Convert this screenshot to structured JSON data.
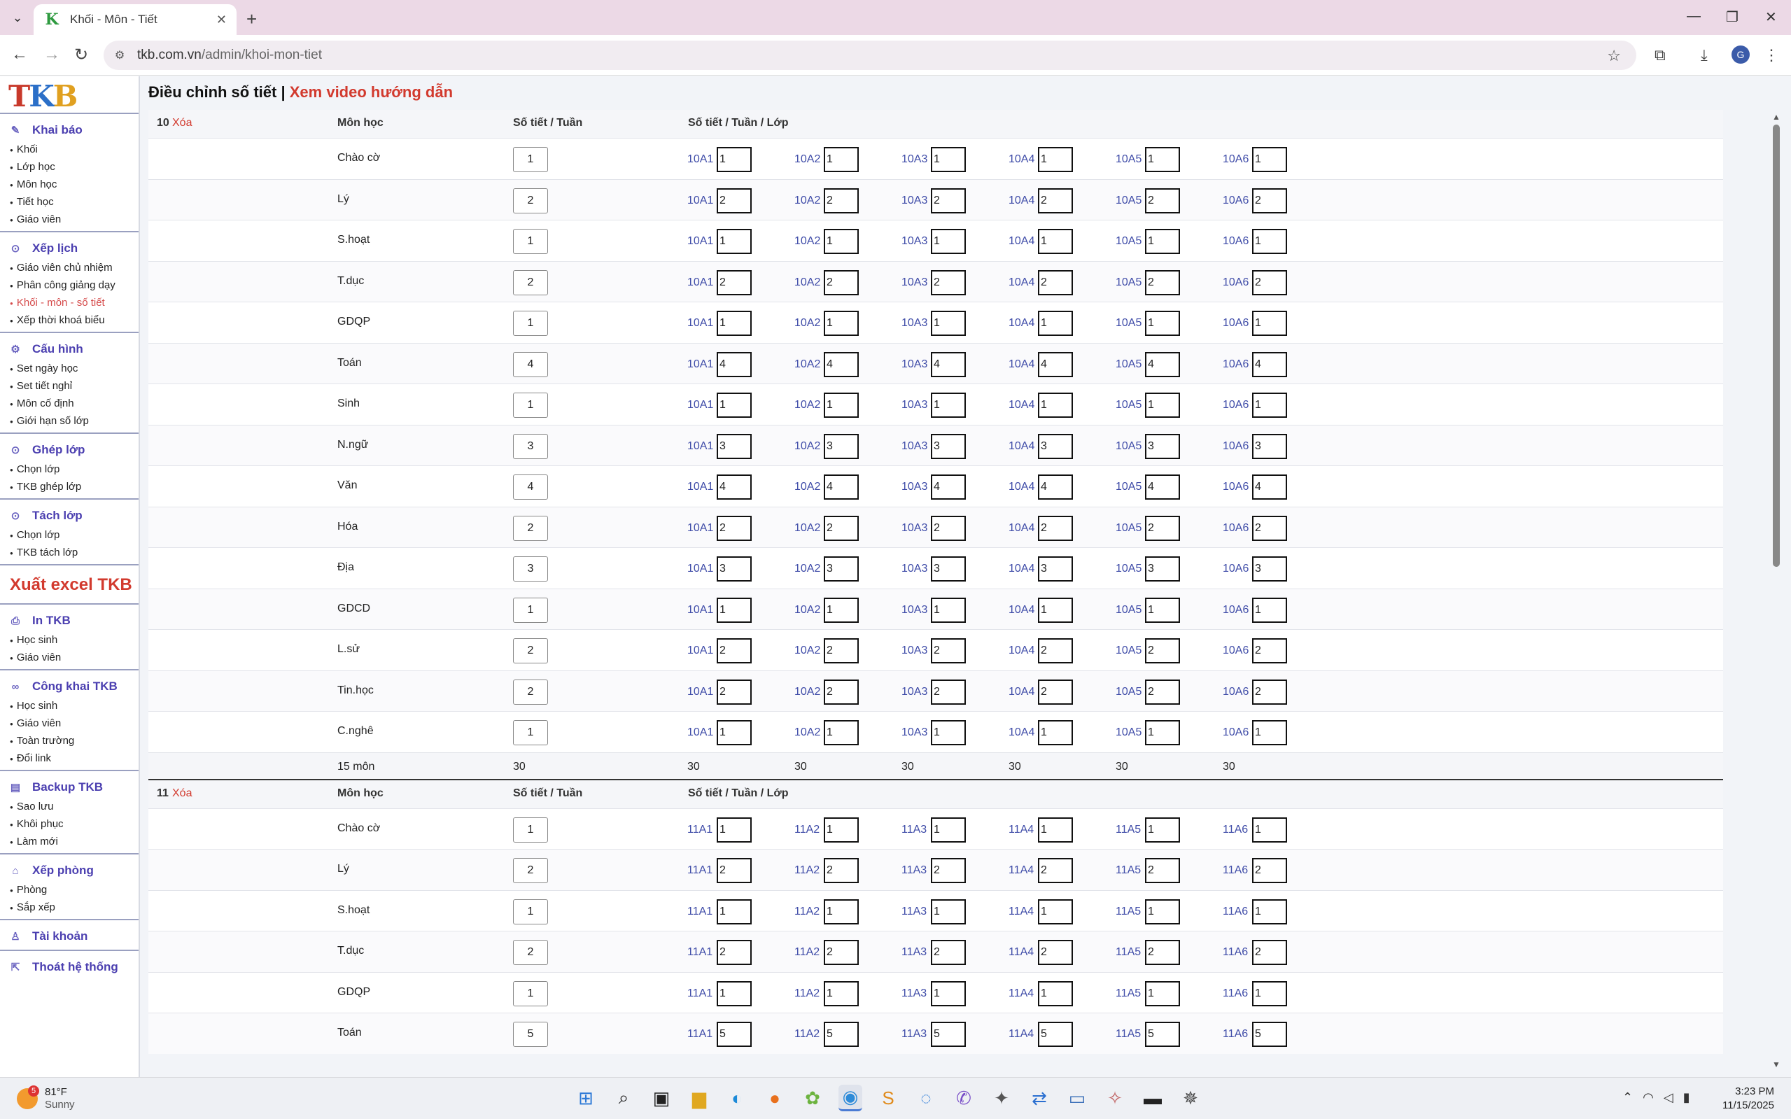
{
  "browser": {
    "tab_title": "Khối - Môn - Tiết",
    "tab_favicon": "K",
    "url_domain": "tkb.com.vn",
    "url_path": "/admin/khoi-mon-tiet",
    "profile_initial": "G"
  },
  "logo": {
    "t1": "T",
    "t2": "K",
    "t3": "B"
  },
  "sidebar": {
    "khai_bao": {
      "title": "Khai báo",
      "items": [
        "Khối",
        "Lớp học",
        "Môn học",
        "Tiết học",
        "Giáo viên"
      ]
    },
    "xep_lich": {
      "title": "Xếp lịch",
      "items": [
        "Giáo viên chủ nhiệm",
        "Phân công giảng dạy",
        "Khối - môn - số tiết",
        "Xếp thời khoá biểu"
      ]
    },
    "cau_hinh": {
      "title": "Cấu hình",
      "items": [
        "Set ngày học",
        "Set tiết nghỉ",
        "Môn cố định",
        "Giới hạn số lớp"
      ]
    },
    "ghep_lop": {
      "title": "Ghép lớp",
      "items": [
        "Chọn lớp",
        "TKB ghép lớp"
      ]
    },
    "tach_lop": {
      "title": "Tách lớp",
      "items": [
        "Chọn lớp",
        "TKB tách lớp"
      ]
    },
    "xuat_excel": "Xuất excel TKB",
    "in_tkb": {
      "title": "In TKB",
      "items": [
        "Học sinh",
        "Giáo viên"
      ]
    },
    "cong_khai": {
      "title": "Công khai TKB",
      "items": [
        "Học sinh",
        "Giáo viên",
        "Toàn trường",
        "Đổi link"
      ]
    },
    "backup": {
      "title": "Backup TKB",
      "items": [
        "Sao lưu",
        "Khôi phục",
        "Làm mới"
      ]
    },
    "xep_phong": {
      "title": "Xếp phòng",
      "items": [
        "Phòng",
        "Sắp xếp"
      ]
    },
    "tai_khoan": {
      "title": "Tài khoản"
    },
    "thoat": {
      "title": "Thoát hệ thống"
    }
  },
  "page": {
    "title": "Điều chỉnh số tiết",
    "separator": " | ",
    "video_link": "Xem video hướng dẫn"
  },
  "headers": {
    "del": "Xóa",
    "mon_hoc": "Môn học",
    "so_tiet_tuan": "Số tiết / Tuần",
    "so_tiet_tuan_lop": "Số tiết / Tuần / Lớp"
  },
  "grades": [
    {
      "grade": "10",
      "classes": [
        "10A1",
        "10A2",
        "10A3",
        "10A4",
        "10A5",
        "10A6"
      ],
      "subjects": [
        {
          "name": "Chào cờ",
          "total": "1",
          "per_class": [
            "1",
            "1",
            "1",
            "1",
            "1",
            "1"
          ]
        },
        {
          "name": "Lý",
          "total": "2",
          "per_class": [
            "2",
            "2",
            "2",
            "2",
            "2",
            "2"
          ]
        },
        {
          "name": "S.hoạt",
          "total": "1",
          "per_class": [
            "1",
            "1",
            "1",
            "1",
            "1",
            "1"
          ]
        },
        {
          "name": "T.dục",
          "total": "2",
          "per_class": [
            "2",
            "2",
            "2",
            "2",
            "2",
            "2"
          ]
        },
        {
          "name": "GDQP",
          "total": "1",
          "per_class": [
            "1",
            "1",
            "1",
            "1",
            "1",
            "1"
          ]
        },
        {
          "name": "Toán",
          "total": "4",
          "per_class": [
            "4",
            "4",
            "4",
            "4",
            "4",
            "4"
          ]
        },
        {
          "name": "Sinh",
          "total": "1",
          "per_class": [
            "1",
            "1",
            "1",
            "1",
            "1",
            "1"
          ]
        },
        {
          "name": "N.ngữ",
          "total": "3",
          "per_class": [
            "3",
            "3",
            "3",
            "3",
            "3",
            "3"
          ]
        },
        {
          "name": "Văn",
          "total": "4",
          "per_class": [
            "4",
            "4",
            "4",
            "4",
            "4",
            "4"
          ]
        },
        {
          "name": "Hóa",
          "total": "2",
          "per_class": [
            "2",
            "2",
            "2",
            "2",
            "2",
            "2"
          ]
        },
        {
          "name": "Địa",
          "total": "3",
          "per_class": [
            "3",
            "3",
            "3",
            "3",
            "3",
            "3"
          ]
        },
        {
          "name": "GDCD",
          "total": "1",
          "per_class": [
            "1",
            "1",
            "1",
            "1",
            "1",
            "1"
          ]
        },
        {
          "name": "L.sử",
          "total": "2",
          "per_class": [
            "2",
            "2",
            "2",
            "2",
            "2",
            "2"
          ]
        },
        {
          "name": "Tin.học",
          "total": "2",
          "per_class": [
            "2",
            "2",
            "2",
            "2",
            "2",
            "2"
          ]
        },
        {
          "name": "C.nghê",
          "total": "1",
          "per_class": [
            "1",
            "1",
            "1",
            "1",
            "1",
            "1"
          ]
        }
      ],
      "footer": {
        "count": "15 môn",
        "total": "30",
        "per_class": [
          "30",
          "30",
          "30",
          "30",
          "30",
          "30"
        ]
      }
    },
    {
      "grade": "11",
      "classes": [
        "11A1",
        "11A2",
        "11A3",
        "11A4",
        "11A5",
        "11A6"
      ],
      "subjects": [
        {
          "name": "Chào cờ",
          "total": "1",
          "per_class": [
            "1",
            "1",
            "1",
            "1",
            "1",
            "1"
          ]
        },
        {
          "name": "Lý",
          "total": "2",
          "per_class": [
            "2",
            "2",
            "2",
            "2",
            "2",
            "2"
          ]
        },
        {
          "name": "S.hoạt",
          "total": "1",
          "per_class": [
            "1",
            "1",
            "1",
            "1",
            "1",
            "1"
          ]
        },
        {
          "name": "T.dục",
          "total": "2",
          "per_class": [
            "2",
            "2",
            "2",
            "2",
            "2",
            "2"
          ]
        },
        {
          "name": "GDQP",
          "total": "1",
          "per_class": [
            "1",
            "1",
            "1",
            "1",
            "1",
            "1"
          ]
        },
        {
          "name": "Toán",
          "total": "5",
          "per_class": [
            "5",
            "5",
            "5",
            "5",
            "5",
            "5"
          ]
        }
      ]
    }
  ],
  "taskbar": {
    "weather_temp": "81°F",
    "weather_desc": "Sunny",
    "weather_badge": "5",
    "time": "3:23 PM",
    "date": "11/15/2025"
  }
}
